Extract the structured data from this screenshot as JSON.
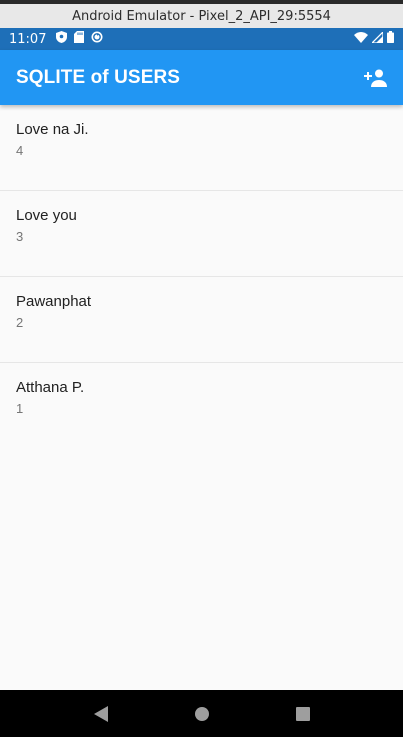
{
  "window": {
    "title": "Android Emulator - Pixel_2_API_29:5554"
  },
  "status_bar": {
    "time": "11:07",
    "left_icons": [
      "shield-icon",
      "sd-card-icon",
      "sync-icon"
    ],
    "right_icons": [
      "wifi-icon",
      "signal-icon",
      "battery-icon"
    ]
  },
  "app_bar": {
    "title": "SQLITE of USERS",
    "action_icon": "person-add-icon",
    "color": "#2196f3"
  },
  "users": [
    {
      "name": "Love na Ji.",
      "id": "4"
    },
    {
      "name": "Love you",
      "id": "3"
    },
    {
      "name": "Pawanphat",
      "id": "2"
    },
    {
      "name": "Atthana P.",
      "id": "1"
    }
  ],
  "nav_bar": {
    "buttons": [
      "back-icon",
      "home-icon",
      "recents-icon"
    ]
  }
}
